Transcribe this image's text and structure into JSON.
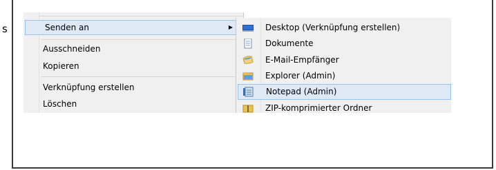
{
  "partial_text": "s",
  "context_menu": {
    "items": [
      {
        "label": "Senden an",
        "has_submenu": true
      },
      {
        "label": "Ausschneiden"
      },
      {
        "label": "Kopieren"
      },
      {
        "label": "Verknüpfung erstellen"
      },
      {
        "label": "Löschen"
      }
    ]
  },
  "send_to_submenu": {
    "items": [
      {
        "label": "Desktop (Verknüpfung erstellen)",
        "icon": "desktop-icon"
      },
      {
        "label": "Dokumente",
        "icon": "documents-icon"
      },
      {
        "label": "E-Mail-Empfänger",
        "icon": "mail-recipient-icon"
      },
      {
        "label": "Explorer (Admin)",
        "icon": "explorer-icon"
      },
      {
        "label": "Notepad (Admin)",
        "icon": "notepad-icon",
        "highlighted": true
      },
      {
        "label": "ZIP-komprimierter Ordner",
        "icon": "zip-folder-icon"
      }
    ]
  },
  "colors": {
    "menu_bg": "#f0f0f0",
    "highlight_bg": "#dfe9f6",
    "highlight_border": "#99c3ea"
  }
}
